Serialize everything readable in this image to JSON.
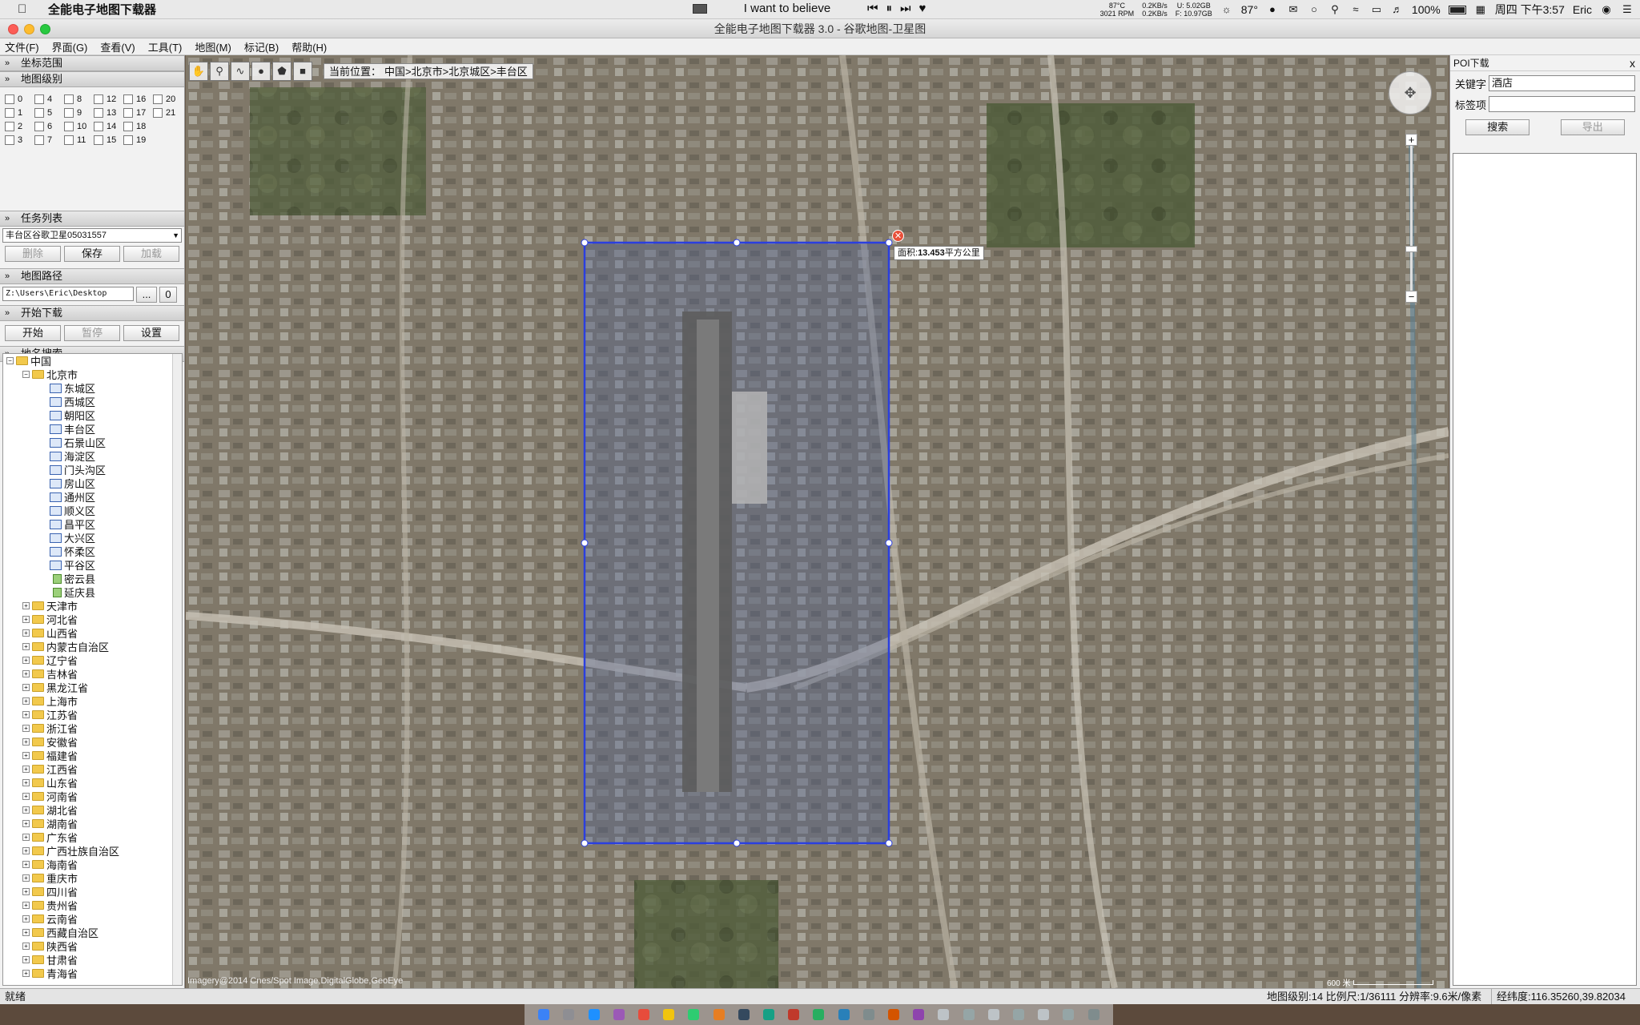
{
  "menubar": {
    "app_name": "全能电子地图下载器",
    "now_playing": "I want to believe",
    "temp_top": "87°C",
    "rpm": "3021 RPM",
    "net_up": "0.2KB/s",
    "net_down": "0.2KB/s",
    "disk_u": "U: 5.02GB",
    "disk_f": "F: 10.97GB",
    "weather": "87°",
    "battery": "100%",
    "clock": "周四 下午3:57",
    "user": "Eric"
  },
  "window": {
    "title": "全能电子地图下载器 3.0 - 谷歌地图-卫星图"
  },
  "app_menu": [
    "文件(F)",
    "界面(G)",
    "查看(V)",
    "工具(T)",
    "地图(M)",
    "标记(B)",
    "帮助(H)"
  ],
  "left": {
    "sec_coords": "坐标范围",
    "sec_levels": "地图级别",
    "levels": [
      "0",
      "4",
      "8",
      "12",
      "16",
      "20",
      "1",
      "5",
      "9",
      "13",
      "17",
      "21",
      "2",
      "6",
      "10",
      "14",
      "18",
      "",
      "3",
      "7",
      "11",
      "15",
      "19",
      ""
    ],
    "sec_tasks": "任务列表",
    "task_selected": "丰台区谷歌卫星05031557",
    "btn_delete": "删除",
    "btn_save": "保存",
    "btn_load": "加载",
    "sec_path": "地图路径",
    "path_value": "Z:\\Users\\Eric\\Desktop",
    "btn_browse": "...",
    "btn_zero": "0",
    "sec_download": "开始下载",
    "btn_start": "开始",
    "btn_pause": "暂停",
    "btn_settings": "设置",
    "sec_search": "地名搜索",
    "tree_root": "中国",
    "tree_beijing": "北京市",
    "beijing_districts": [
      "东城区",
      "西城区",
      "朝阳区",
      "丰台区",
      "石景山区",
      "海淀区",
      "门头沟区",
      "房山区",
      "通州区",
      "顺义区",
      "昌平区",
      "大兴区",
      "怀柔区",
      "平谷区"
    ],
    "beijing_counties": [
      "密云县",
      "延庆县"
    ],
    "provinces": [
      "天津市",
      "河北省",
      "山西省",
      "内蒙古自治区",
      "辽宁省",
      "吉林省",
      "黑龙江省",
      "上海市",
      "江苏省",
      "浙江省",
      "安徽省",
      "福建省",
      "江西省",
      "山东省",
      "河南省",
      "湖北省",
      "湖南省",
      "广东省",
      "广西壮族自治区",
      "海南省",
      "重庆市",
      "四川省",
      "贵州省",
      "云南省",
      "西藏自治区",
      "陕西省",
      "甘肃省",
      "青海省"
    ]
  },
  "map": {
    "current_location_label": "当前位置：",
    "current_location": "中国>北京市>北京城区>丰台区",
    "area_label": "面积:",
    "area_value": "13.453",
    "area_unit": "平方公里",
    "imagery_credit": "Imagery@2014 Cnes/Spot Image,DigitalGlobe,GeoEye",
    "scale_text": "600 米",
    "tool_icons": [
      "hand-icon",
      "marker-icon",
      "polyline-icon",
      "circle-icon",
      "polygon-icon",
      "rectangle-icon"
    ],
    "selection_color": "#2a3fe0"
  },
  "right": {
    "title": "POI下载",
    "close": "x",
    "keyword_label": "关键字",
    "keyword_value": "酒店",
    "tag_label": "标签项",
    "tag_value": "",
    "btn_search": "搜索",
    "btn_export": "导出"
  },
  "status": {
    "left": "就绪",
    "mid": "地图级别:14 比例尺:1/36111 分辨率:9.6米/像素",
    "right": "经纬度:116.35260,39.82034"
  }
}
